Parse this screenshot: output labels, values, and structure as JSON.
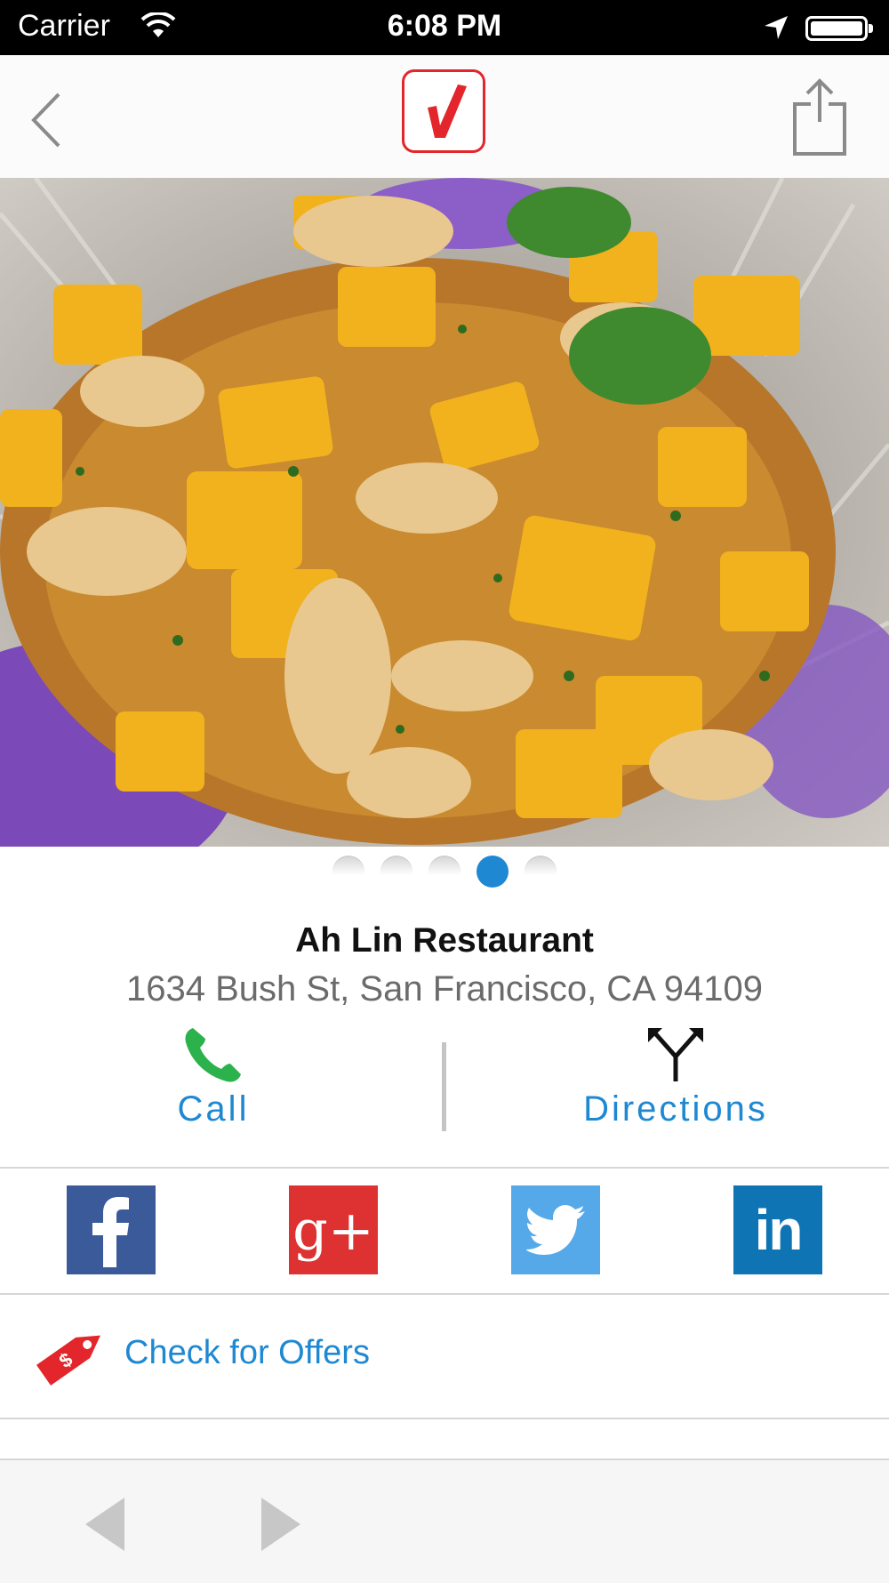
{
  "status_bar": {
    "carrier": "Carrier",
    "time": "6:08 PM"
  },
  "nav": {
    "back_icon": "chevron-left-icon",
    "logo_icon": "checkmark-logo-icon",
    "share_icon": "share-icon"
  },
  "gallery": {
    "photo_subject": "food-photo",
    "page_count": 5,
    "active_page": 4
  },
  "restaurant": {
    "name": "Ah Lin Restaurant",
    "address": "1634 Bush St, San Francisco, CA 94109"
  },
  "actions": {
    "call_label": "Call",
    "directions_label": "Directions"
  },
  "social": [
    {
      "network": "facebook",
      "glyph": "f",
      "color": "#3b5a9a"
    },
    {
      "network": "google-plus",
      "glyph": "g+",
      "color": "#dd3231"
    },
    {
      "network": "twitter",
      "glyph": "bird",
      "color": "#56a9e8"
    },
    {
      "network": "linkedin",
      "glyph": "in",
      "color": "#0f74b3"
    }
  ],
  "offers": {
    "label": "Check for Offers"
  },
  "colors": {
    "accent_blue": "#1e88d2",
    "brand_red": "#e2262b",
    "call_green": "#2bb24c"
  }
}
